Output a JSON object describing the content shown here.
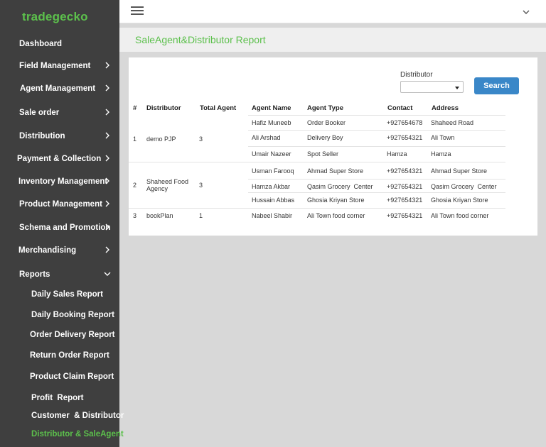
{
  "app": {
    "brand": "tradegecko"
  },
  "sidebar": {
    "items": [
      {
        "label": "Dashboard",
        "chevron": ""
      },
      {
        "label": "Field Management",
        "chevron": "right"
      },
      {
        "label": "Agent Management",
        "chevron": "right"
      },
      {
        "label": "Sale order",
        "chevron": "right"
      },
      {
        "label": "Distribution",
        "chevron": "right"
      },
      {
        "label": "Payment & Collection",
        "chevron": "right"
      },
      {
        "label": "Inventory Management",
        "chevron": "right"
      },
      {
        "label": "Product Management",
        "chevron": "right"
      },
      {
        "label": "Schema and Promotion",
        "chevron": "right"
      },
      {
        "label": "Merchandising",
        "chevron": "right"
      },
      {
        "label": "Reports",
        "chevron": "down"
      }
    ],
    "sub_items": [
      {
        "label": "Daily Sales Report"
      },
      {
        "label": "Daily Booking Report"
      },
      {
        "label": "Order Delivery Report"
      },
      {
        "label": "Return Order Report"
      },
      {
        "label": "Product Claim Report"
      },
      {
        "label": "Profit  Report"
      },
      {
        "label": "Customer  & Distributor"
      },
      {
        "label": "Distributor & SaleAgent",
        "active": true
      }
    ]
  },
  "header": {
    "menu_icon": "hamburger-icon",
    "chevron_icon": "chevron-down-icon"
  },
  "page": {
    "title": "SaleAgent&Distributor Report"
  },
  "filter": {
    "label": "Distributor",
    "selected_value": "",
    "search_label": "Search"
  },
  "colors": {
    "brand": "#5cc04c",
    "sidebar_bg": "#3f3f3f",
    "button": "#3a87c8"
  },
  "table": {
    "headers": [
      "#",
      "Distributor",
      "Total Agent",
      "Agent Name",
      "Agent Type",
      "Contact",
      "Address"
    ],
    "groups": [
      {
        "num": "1",
        "distributor": [
          "demo PJP"
        ],
        "total_agent": "3",
        "agents": [
          {
            "name": "Hafiz Muneeb",
            "type": "Order Booker",
            "contact": "+927654678",
            "address": "Shaheed Road"
          },
          {
            "name": "Ali Arshad",
            "type": "Delivery Boy",
            "contact": "+927654321",
            "address": "Ali Town"
          },
          {
            "name": "Umair Nazeer",
            "type": "Spot Seller",
            "contact": "Hamza",
            "address": "Hamza"
          }
        ]
      },
      {
        "num": "2",
        "distributor": [
          "Shaheed Food",
          "Agency"
        ],
        "total_agent": "3",
        "agents": [
          {
            "name": "Usman Farooq",
            "type": "Ahmad Super Store",
            "contact": "+927654321",
            "address": "Ahmad Super Store"
          },
          {
            "name": "Hamza Akbar",
            "type": "Qasim Grocery  Center",
            "contact": "+927654321",
            "address": "Qasim Grocery  Center"
          },
          {
            "name": "Hussain Abbas",
            "type": "Ghosia Kriyan Store",
            "contact": "+927654321",
            "address": "Ghosia Kriyan Store"
          }
        ]
      },
      {
        "num": "3",
        "distributor": [
          "bookPlan"
        ],
        "total_agent": "1",
        "agents": [
          {
            "name": "Nabeel Shabir",
            "type": "Ali Town food corner",
            "contact": "+927654321",
            "address": "Ali Town food corner"
          }
        ]
      }
    ]
  }
}
